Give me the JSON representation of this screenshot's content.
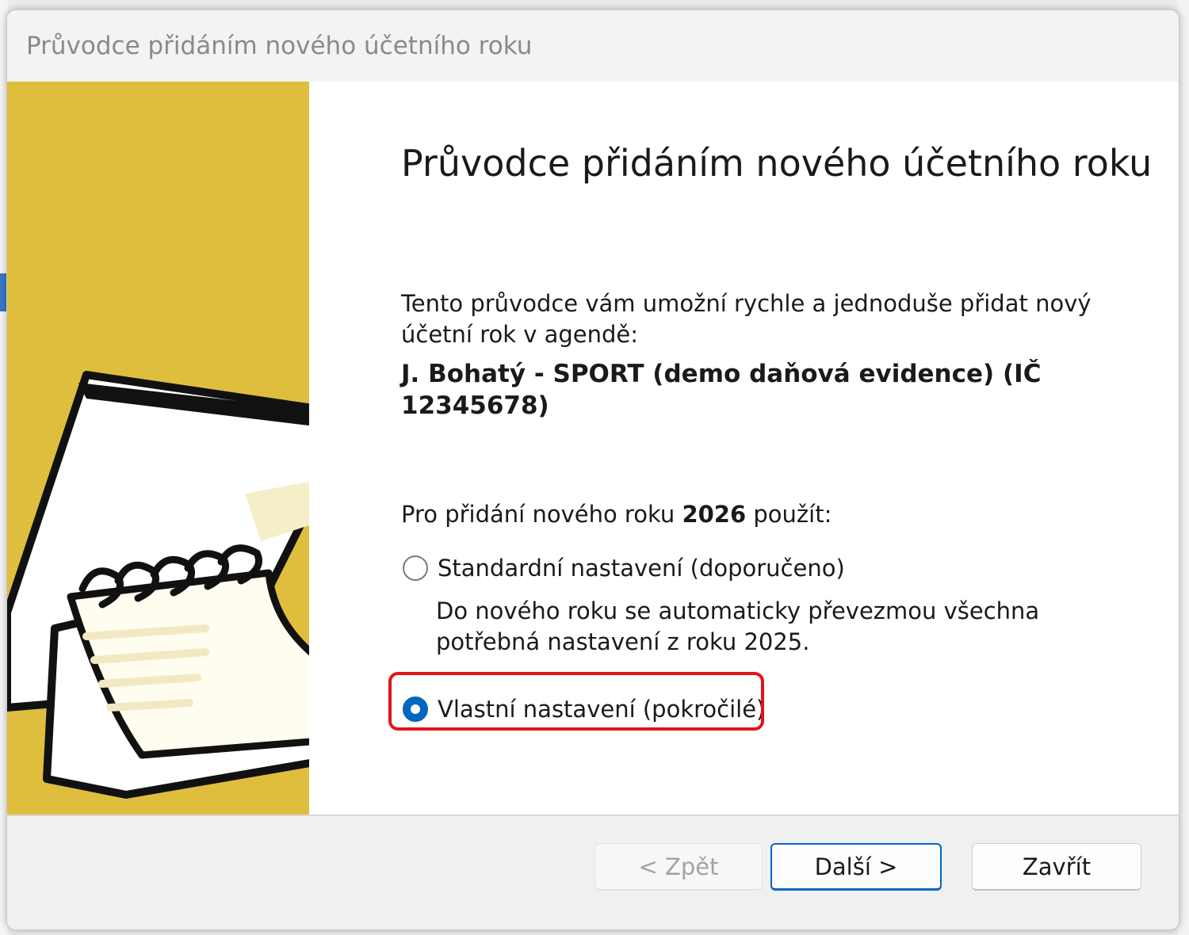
{
  "window": {
    "title": "Průvodce přidáním nového účetního roku"
  },
  "content": {
    "heading": "Průvodce přidáním nového účetního roku",
    "intro": "Tento průvodce vám umožní rychle a jednoduše přidat nový účetní rok v agendě:",
    "agenda": "J. Bohatý - SPORT (demo daňová evidence) (IČ 12345678)",
    "year_prefix": "Pro přidání nového roku",
    "year": "2026",
    "year_suffix": "použít:"
  },
  "options": [
    {
      "label": "Standardní nastavení (doporučeno)",
      "description": "Do nového roku se automaticky převezmou všechna potřebná nastavení z roku 2025.",
      "selected": false
    },
    {
      "label": "Vlastní nastavení (pokročilé)",
      "selected": true
    }
  ],
  "buttons": {
    "back": "< Zpět",
    "next": "Další >",
    "close": "Zavřít"
  },
  "colors": {
    "side_panel": "#dfbe3d",
    "accent": "#0067c0",
    "highlight": "#e0141c"
  },
  "icons": {
    "side_art": "notepad-illustration"
  }
}
